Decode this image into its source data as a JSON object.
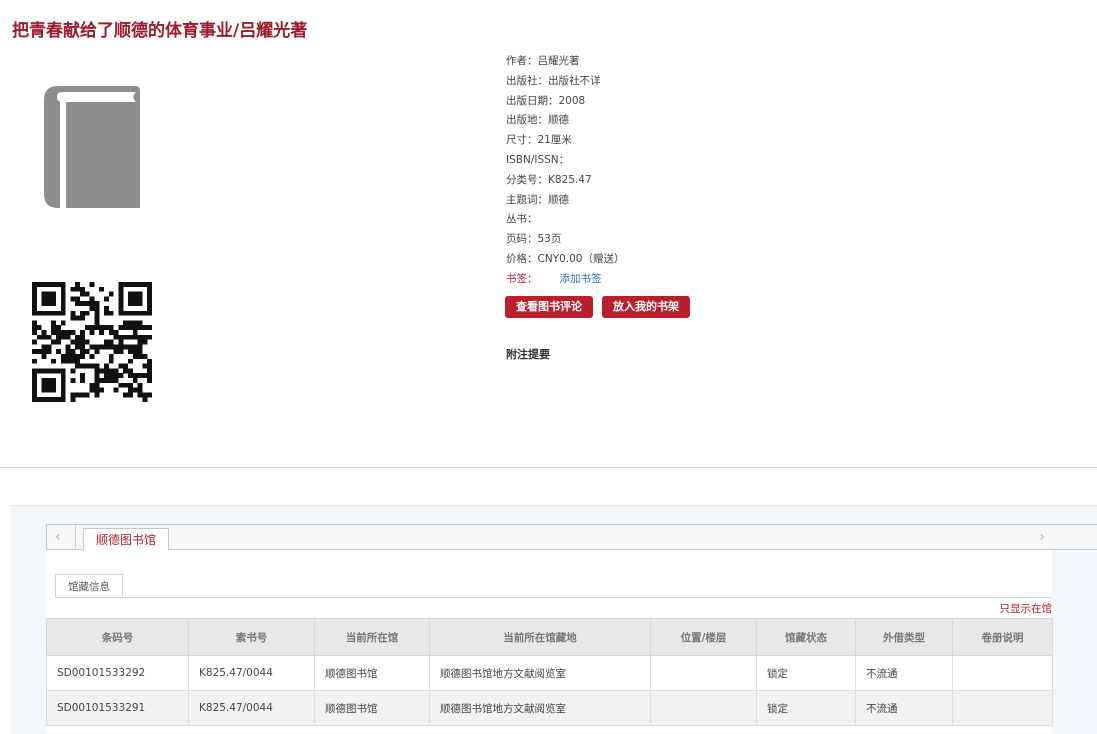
{
  "book": {
    "title_main": "把青春献给了顺德的体育事业",
    "title_sep": "/",
    "title_author": "吕耀光著"
  },
  "meta": [
    "作者：吕耀光著",
    "出版社：出版社不详",
    "出版日期：2008",
    "出版地：顺德",
    "尺寸：21厘米",
    "ISBN/ISSN：",
    "分类号：K825.47",
    "主题词：顺德",
    "丛书：",
    "页码：53页",
    "价格：CNY0.00（赠送）"
  ],
  "bookmark": {
    "label": "书签：",
    "link": "添加书签"
  },
  "buttons": {
    "review": "查看图书评论",
    "shelf": "放入我的书架"
  },
  "note_title": "附注提要",
  "tabs": {
    "library": "顺德图书馆",
    "sub": "馆藏信息",
    "prev_arrow": "‹",
    "next_arrow": "›"
  },
  "filter_link": "只显示在馆",
  "table": {
    "headers": [
      "条码号",
      "索书号",
      "当前所在馆",
      "当前所在馆藏地",
      "位置/楼层",
      "馆藏状态",
      "外借类型",
      "卷册说明"
    ],
    "rows": [
      [
        "SD00101533292",
        "K825.47/0044",
        "顺德图书馆",
        "顺德图书馆地方文献阅览室",
        "",
        "锁定",
        "不流通",
        ""
      ],
      [
        "SD00101533291",
        "K825.47/0044",
        "顺德图书馆",
        "顺德图书馆地方文献阅览室",
        "",
        "锁定",
        "不流通",
        ""
      ]
    ]
  },
  "colors": {
    "accent": "#b8202e",
    "title": "#9b1c2c",
    "link": "#2f6fb5"
  },
  "icons": {
    "cover": "book-cover-icon",
    "qr": "qr-code-icon"
  }
}
